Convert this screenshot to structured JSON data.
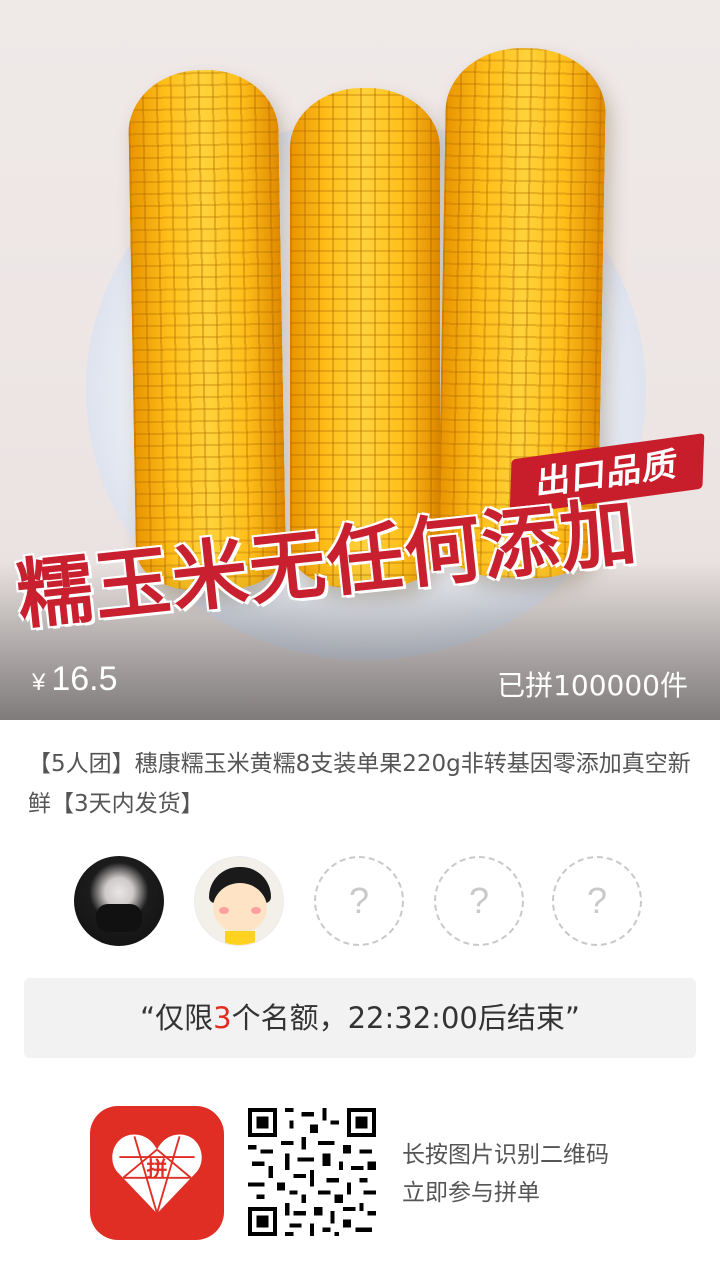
{
  "hero": {
    "badge": "出口品质",
    "slogan": "糯玉米无任何添加",
    "price_symbol": "¥",
    "price": "16.5",
    "sold": "已拼100000件"
  },
  "product": {
    "title": "【5人团】穗康糯玉米黄糯8支装单果220g非转基因零添加真空新鲜【3天内发货】"
  },
  "group": {
    "members": [
      "avatar-1",
      "avatar-2"
    ],
    "empty_slots": [
      "?",
      "?",
      "?"
    ]
  },
  "quota": {
    "prefix": "“仅限",
    "count": "3",
    "suffix": "个名额，22:32:00后结束”"
  },
  "footer": {
    "line1": "长按图片识别二维码",
    "line2": "立即参与拼单",
    "logo_text": "拼"
  },
  "colors": {
    "brand_red": "#e02e24",
    "slogan_red": "#c8202f"
  }
}
